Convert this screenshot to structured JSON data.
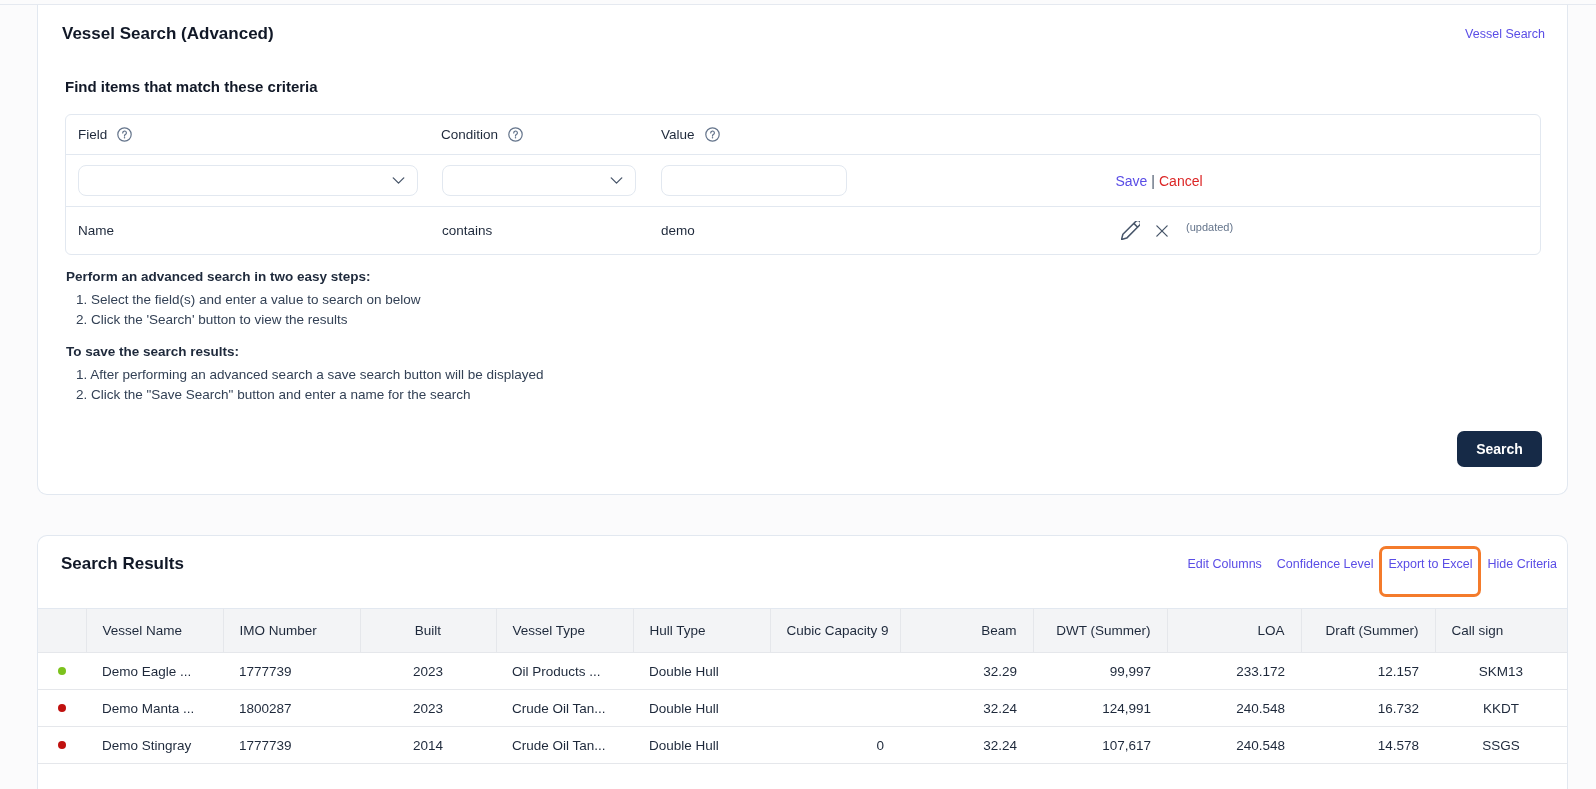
{
  "page": {
    "title": "Vessel Search (Advanced)",
    "link": "Vessel Search"
  },
  "criteria": {
    "title": "Find items that match these criteria",
    "columns": [
      "Field",
      "Condition",
      "Value"
    ],
    "editor": {
      "controls": [
        {
          "kind": "select"
        },
        {
          "kind": "select"
        },
        {
          "kind": "input"
        }
      ],
      "save": "Save",
      "separator": "|",
      "cancel": "Cancel"
    },
    "rows": [
      {
        "field": "Name",
        "condition": "contains",
        "value": "demo",
        "note": "(updated)"
      }
    ]
  },
  "instructions": [
    {
      "heading": "Perform an advanced search in two easy steps:",
      "steps": [
        "1. Select the field(s) and enter a value to search on below",
        "2. Click the 'Search' button to view the results"
      ]
    },
    {
      "heading": "To save the search results:",
      "steps": [
        "1. After performing an advanced search a save search button will be displayed",
        "2. Click the \"Save Search\" button and enter a name for the search"
      ]
    }
  ],
  "search_button": "Search",
  "results": {
    "title": "Search Results",
    "actions": [
      {
        "label": "Edit Columns",
        "highlighted": false
      },
      {
        "label": "Confidence Level",
        "highlighted": false
      },
      {
        "label": "Export to Excel",
        "highlighted": true
      },
      {
        "label": "Hide Criteria",
        "highlighted": false
      }
    ],
    "table": {
      "columns": [
        "Vessel Name",
        "IMO Number",
        "Built",
        "Vessel Type",
        "Hull Type",
        "Cubic Capacity 9",
        "Beam",
        "DWT (Summer)",
        "LOA",
        "Draft (Summer)",
        "Call sign"
      ],
      "rows": [
        {
          "color": "#7cc21c",
          "cells": [
            "Demo Eagle ...",
            "1777739",
            "2023",
            "Oil Products ...",
            "Double Hull",
            null,
            "32.29",
            "99,997",
            "233.172",
            "12.157",
            "SKM13"
          ]
        },
        {
          "color": "#c0110f",
          "cells": [
            "Demo Manta ...",
            "1800287",
            "2023",
            "Crude Oil Tan...",
            "Double Hull",
            null,
            "32.24",
            "124,991",
            "240.548",
            "16.732",
            "KKDT"
          ]
        },
        {
          "color": "#c0110f",
          "cells": [
            "Demo Stingray",
            "1777739",
            "2014",
            "Crude Oil Tan...",
            "Double Hull",
            "0",
            "32.24",
            "107,617",
            "240.548",
            "14.578",
            "SSGS"
          ]
        }
      ]
    }
  }
}
